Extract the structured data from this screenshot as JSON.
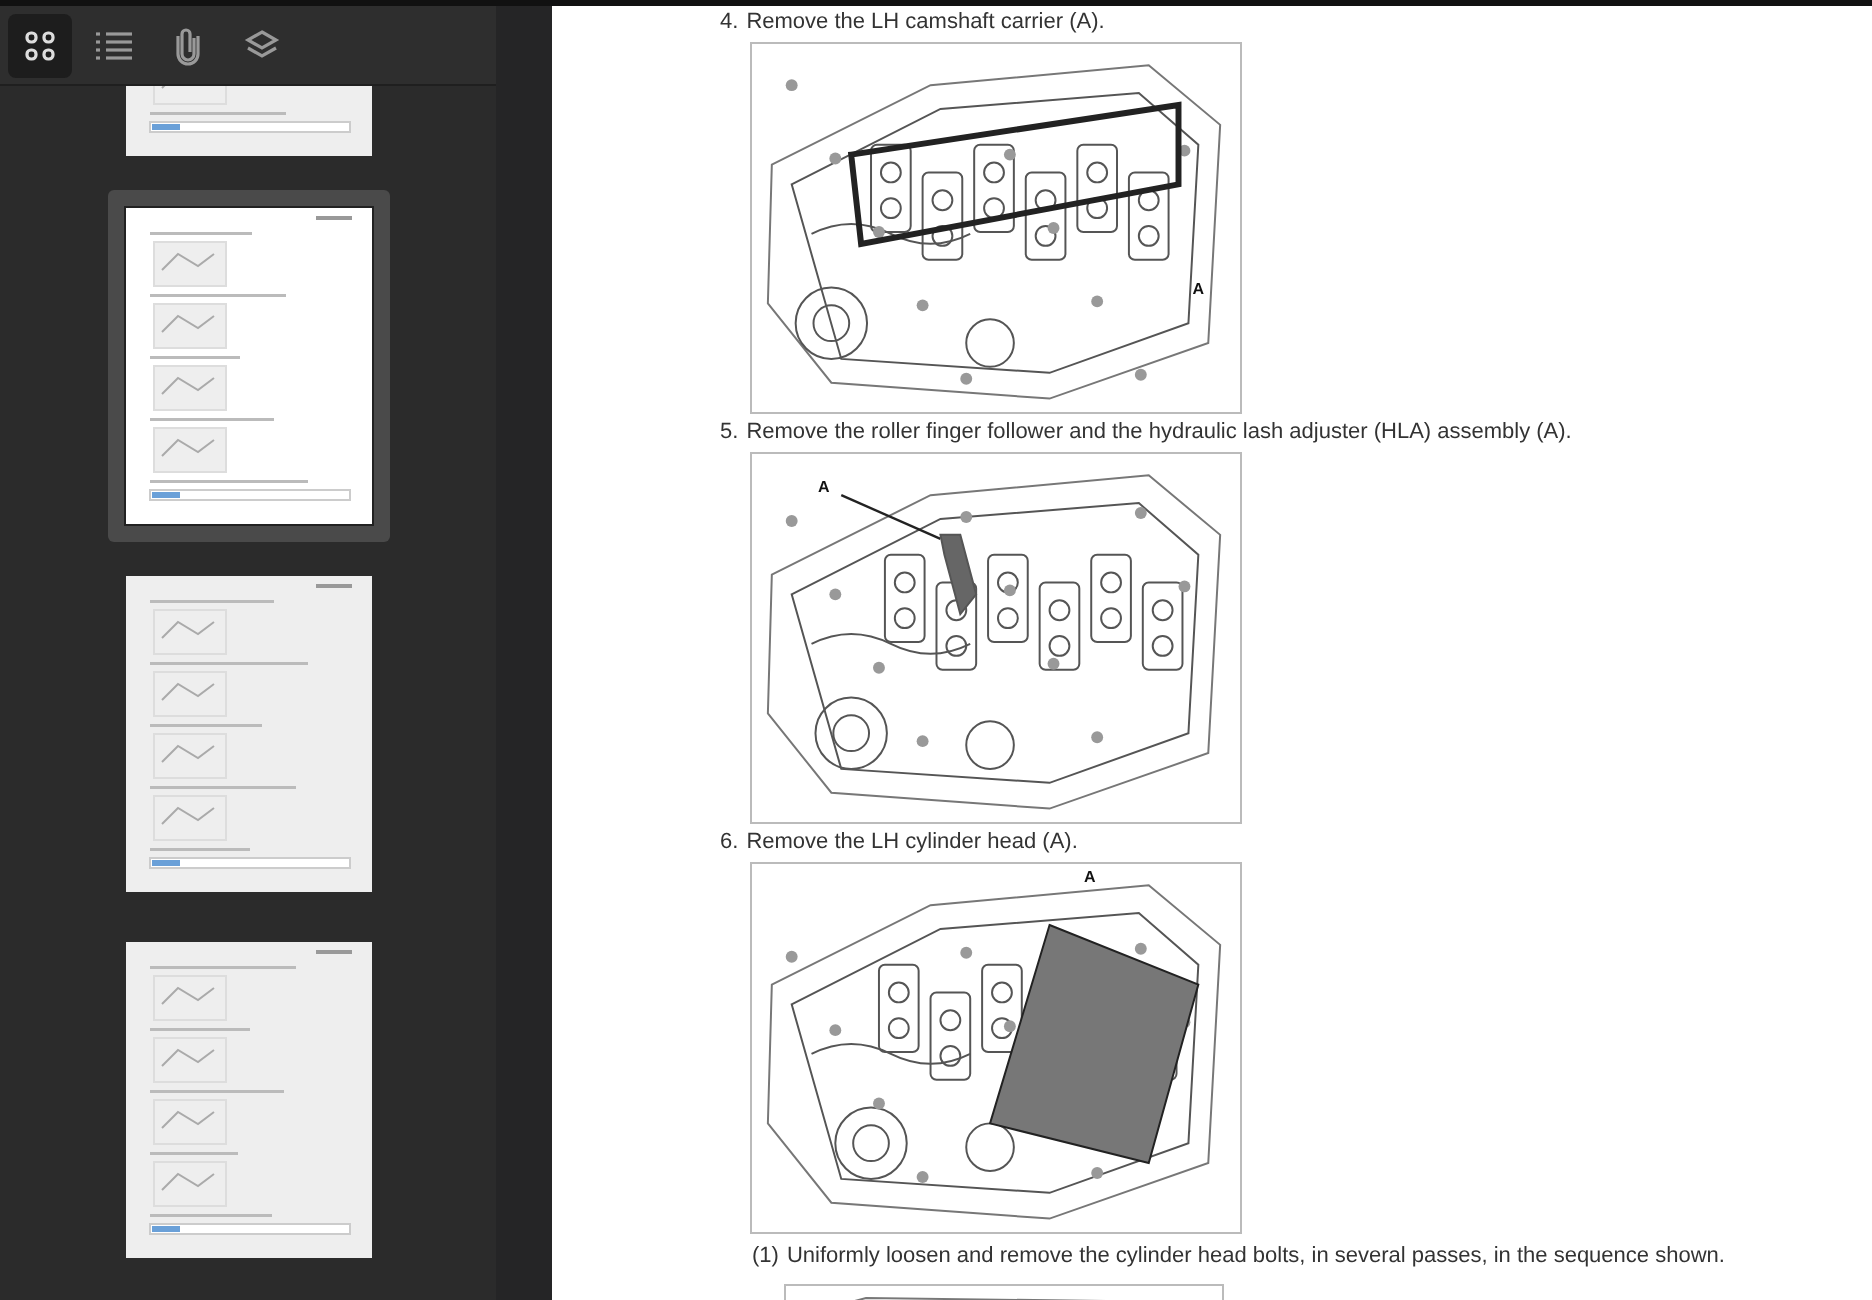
{
  "sidebar": {
    "tools": [
      {
        "kind": "thumbnails",
        "selected": true
      },
      {
        "kind": "outline",
        "selected": false
      },
      {
        "kind": "attachments",
        "selected": false
      },
      {
        "kind": "layers",
        "selected": false
      }
    ],
    "thumbnails": [
      {
        "selected": false
      },
      {
        "selected": true
      },
      {
        "selected": false
      },
      {
        "selected": false
      }
    ]
  },
  "document": {
    "blocks": [
      {
        "kind": "step",
        "number": "4.",
        "text": "Remove the LH camshaft carrier (A)."
      },
      {
        "kind": "figure",
        "callout": "A"
      },
      {
        "kind": "step",
        "number": "5.",
        "text": "Remove the roller finger follower and the hydraulic lash adjuster (HLA) assembly (A)."
      },
      {
        "kind": "figure",
        "callout": "A"
      },
      {
        "kind": "step",
        "number": "6.",
        "text": "Remove the LH cylinder head (A)."
      },
      {
        "kind": "figure",
        "callout": "A"
      },
      {
        "kind": "substep",
        "number": "(1)",
        "text": "Uniformly loosen and remove the cylinder head bolts, in several passes, in the sequence shown."
      },
      {
        "kind": "figure_cut"
      }
    ]
  }
}
